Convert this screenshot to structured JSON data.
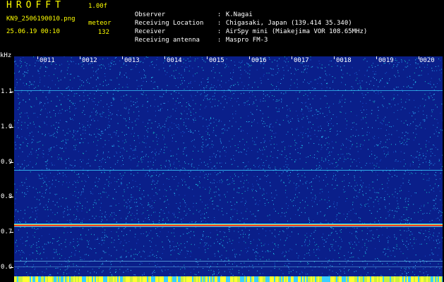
{
  "app": {
    "title": "HROFFT",
    "version": "1.00f"
  },
  "file": {
    "name": "KN9_2506190010.png",
    "datetime": "25.06.19 00:10"
  },
  "meteor": {
    "label": "meteor",
    "count": "132"
  },
  "meta": [
    {
      "key": "Observer",
      "value": "K.Nagai"
    },
    {
      "key": "Receiving Location",
      "value": "Chigasaki, Japan (139.414 35.340)"
    },
    {
      "key": "Receiver",
      "value": "AirSpy mini (Miakejima VOR 108.65MHz)"
    },
    {
      "key": "Receiving antenna",
      "value": "Maspro FM-3"
    }
  ],
  "spectrogram": {
    "unit": "kHz",
    "y_ticks": [
      "1.1",
      "1.0",
      "0.9",
      "0.8",
      "0.7",
      "0.6"
    ],
    "time_labels": [
      "0011",
      "0012",
      "0013",
      "0014",
      "0015",
      "0016",
      "0017",
      "0018",
      "0019",
      "0020"
    ],
    "colors": {
      "background": "#0a1f8a",
      "noise": "#2bd1ff",
      "carrier": "#ff3b1f"
    }
  }
}
